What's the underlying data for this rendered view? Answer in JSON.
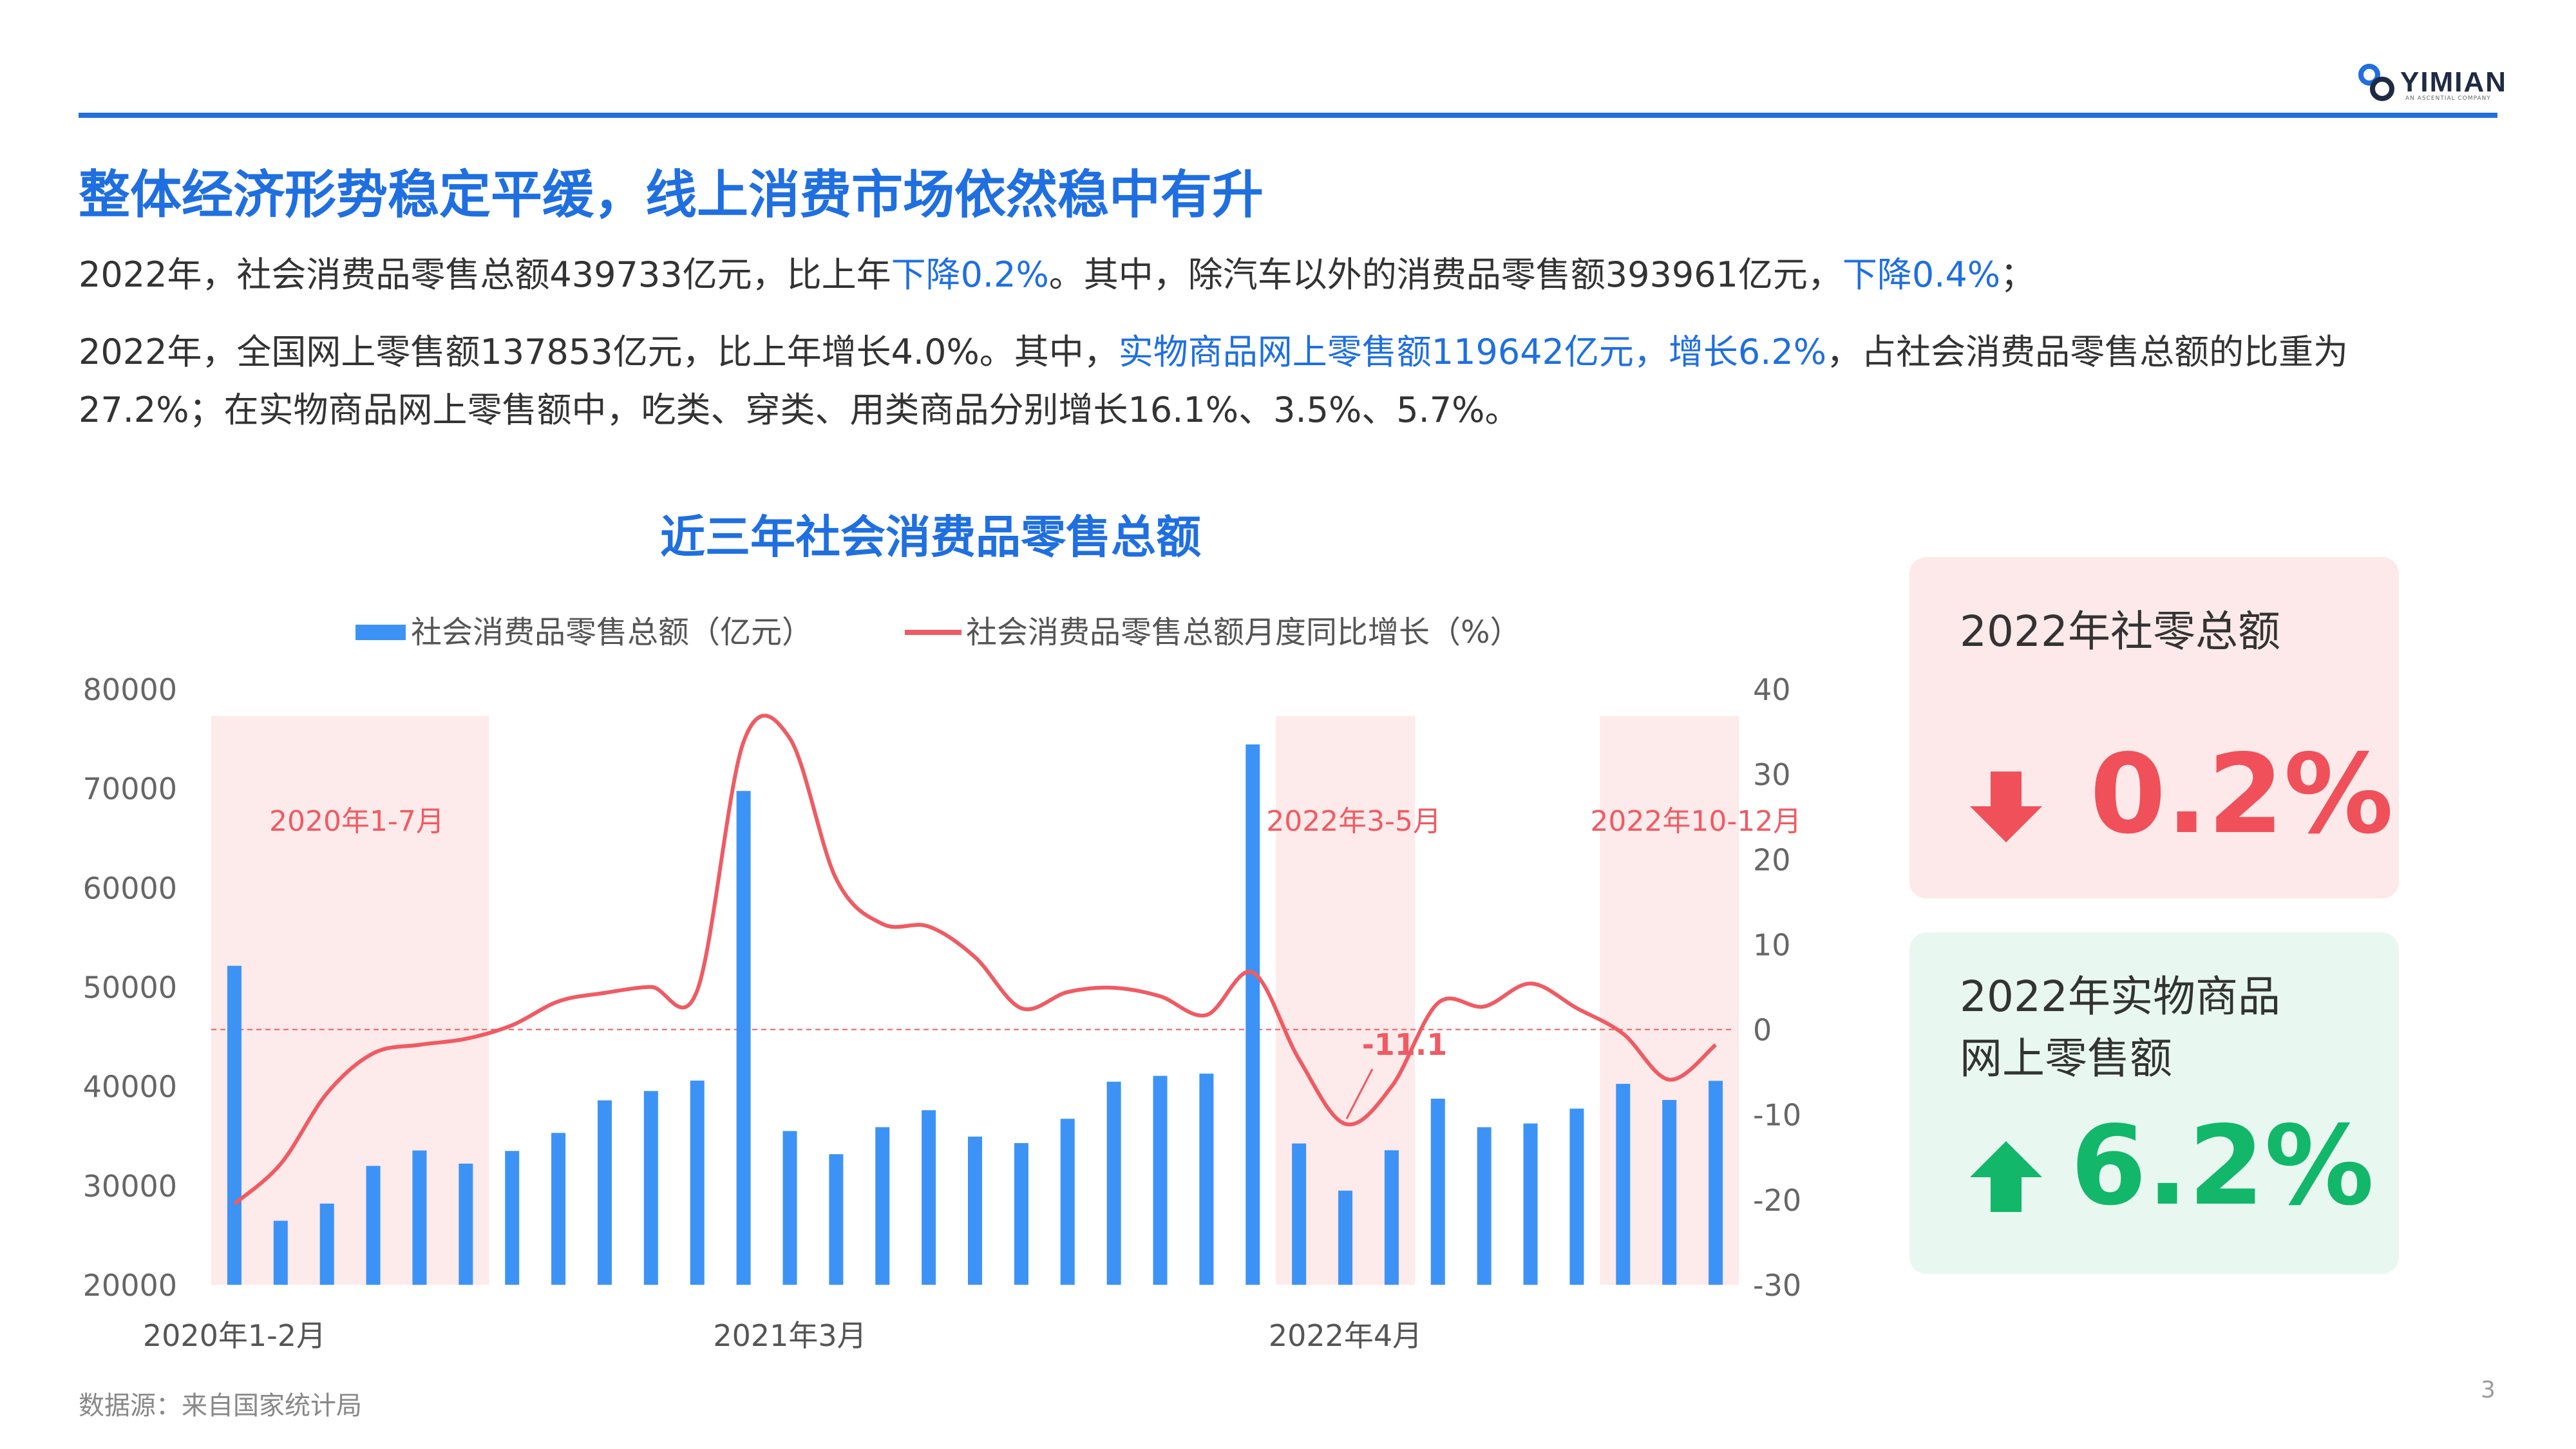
{
  "brand": {
    "name": "YIMIAN",
    "tagline": "AN ASCENTIAL COMPANY"
  },
  "headline": "整体经济形势稳定平缓，线上消费市场依然稳中有升",
  "paragraph1": {
    "part1": "2022年，社会消费品零售总额439733亿元，比上年",
    "part2": "下降0.2%",
    "part3": "。其中，除汽车以外的消费品零售额393961亿元，",
    "part4": "下降0.4%",
    "part5": "；"
  },
  "paragraph2": {
    "part1": "2022年，全国网上零售额137853亿元，比上年增长4.0%。其中，",
    "part2": "实物商品网上零售额119642亿元，增长6.2%",
    "part3": "，占社会消费品零售总额的比重为",
    "line2": "27.2%；在实物商品网上零售额中，吃类、穿类、用类商品分别增长16.1%、3.5%、5.7%。"
  },
  "chart_data": {
    "type": "bar",
    "title": "近三年社会消费品零售总额",
    "series": [
      {
        "name": "社会消费品零售总额（亿元）",
        "type": "bar",
        "axis": "left",
        "values": [
          52130,
          26450,
          28178,
          31973,
          33526,
          32203,
          33478,
          35295,
          38577,
          39514,
          40566,
          69737,
          35484,
          33153,
          35873,
          37586,
          34925,
          34273,
          36719,
          40455,
          41043,
          41269,
          74426,
          34233,
          29483,
          33547,
          38742,
          35870,
          36250,
          37745,
          40236,
          38615,
          40542
        ]
      },
      {
        "name": "社会消费品零售总额月度同比增长（%）",
        "type": "line",
        "axis": "right",
        "values": [
          -20.5,
          -15.8,
          -7.5,
          -2.8,
          -1.8,
          -1.1,
          0.5,
          3.3,
          4.3,
          5.0,
          4.6,
          33.8,
          34.2,
          17.7,
          12.4,
          12.1,
          8.5,
          2.5,
          4.4,
          4.9,
          3.9,
          1.7,
          6.7,
          -3.5,
          -11.1,
          -6.7,
          3.1,
          2.7,
          5.4,
          2.5,
          -0.5,
          -5.9,
          -1.8
        ]
      }
    ],
    "x_tick_labels": [
      {
        "index": 0,
        "label": "2020年1-2月"
      },
      {
        "index": 12,
        "label": "2021年3月"
      },
      {
        "index": 24,
        "label": "2022年4月"
      }
    ],
    "left_axis": {
      "min": 20000,
      "max": 80000,
      "ticks": [
        80000,
        70000,
        60000,
        50000,
        40000,
        30000,
        20000
      ]
    },
    "right_axis": {
      "min": -30,
      "max": 40,
      "ticks": [
        40,
        30,
        20,
        10,
        0,
        -10,
        -20,
        -30
      ]
    },
    "shaded_periods": [
      {
        "label": "2020年1-7月",
        "from": 0,
        "to": 5
      },
      {
        "label": "2022年3-5月",
        "from": 23,
        "to": 25
      },
      {
        "label": "2022年10-12月",
        "from": 30,
        "to": 32
      }
    ],
    "annotation": {
      "text": "-11.1",
      "index": 24
    },
    "zero_line": true,
    "grid": false,
    "legend_position": "top"
  },
  "card1": {
    "label": "2022年社零总额",
    "value": "0.2%",
    "direction": "down",
    "color": "#f0505a"
  },
  "card2": {
    "label_line1": "2022年实物商品",
    "label_line2": "网上零售额",
    "value": "6.2%",
    "direction": "up",
    "color": "#12b76a"
  },
  "source": "数据源：来自国家统计局",
  "page_number": "3",
  "colors": {
    "accent": "#1f6fe0",
    "bar": "#3d93f5",
    "line": "#ef5b63",
    "shade": "#fdeaea"
  }
}
